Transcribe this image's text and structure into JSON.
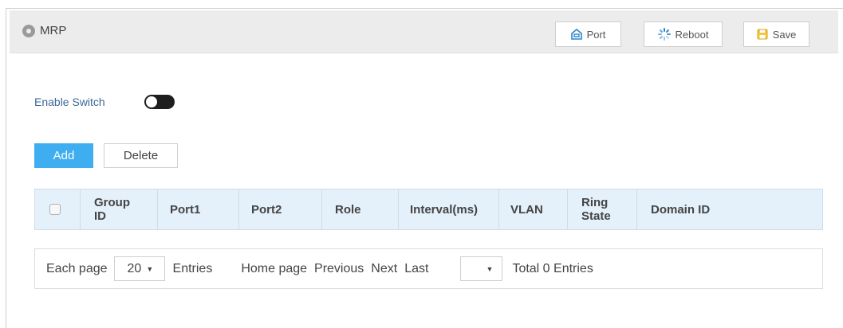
{
  "header": {
    "title": "MRP",
    "buttons": {
      "port": "Port",
      "reboot": "Reboot",
      "save": "Save"
    }
  },
  "enable_switch": {
    "label": "Enable Switch",
    "state": "off"
  },
  "actions": {
    "add": "Add",
    "delete": "Delete"
  },
  "table": {
    "columns": [
      {
        "line1": "Group",
        "line2": "ID"
      },
      {
        "line1": "Port1",
        "line2": ""
      },
      {
        "line1": "Port2",
        "line2": ""
      },
      {
        "line1": "Role",
        "line2": ""
      },
      {
        "line1": "Interval(ms)",
        "line2": ""
      },
      {
        "line1": "VLAN",
        "line2": ""
      },
      {
        "line1": "Ring",
        "line2": "State"
      },
      {
        "line1": "Domain ID",
        "line2": ""
      }
    ],
    "rows": []
  },
  "pager": {
    "each_page": "Each page",
    "page_size": "20",
    "entries": "Entries",
    "home": "Home page",
    "previous": "Previous",
    "next": "Next",
    "last": "Last",
    "page_select": "",
    "total": "Total 0 Entries"
  },
  "colors": {
    "accent": "#3eaef0",
    "table_header_bg": "#e4f0fa",
    "header_bg": "#ececec",
    "toggle_off": "#1e1e1e"
  },
  "icons": {
    "title": "map-pin-icon",
    "port": "port-icon",
    "reboot": "reboot-spinner-icon",
    "save": "floppy-disk-icon"
  }
}
